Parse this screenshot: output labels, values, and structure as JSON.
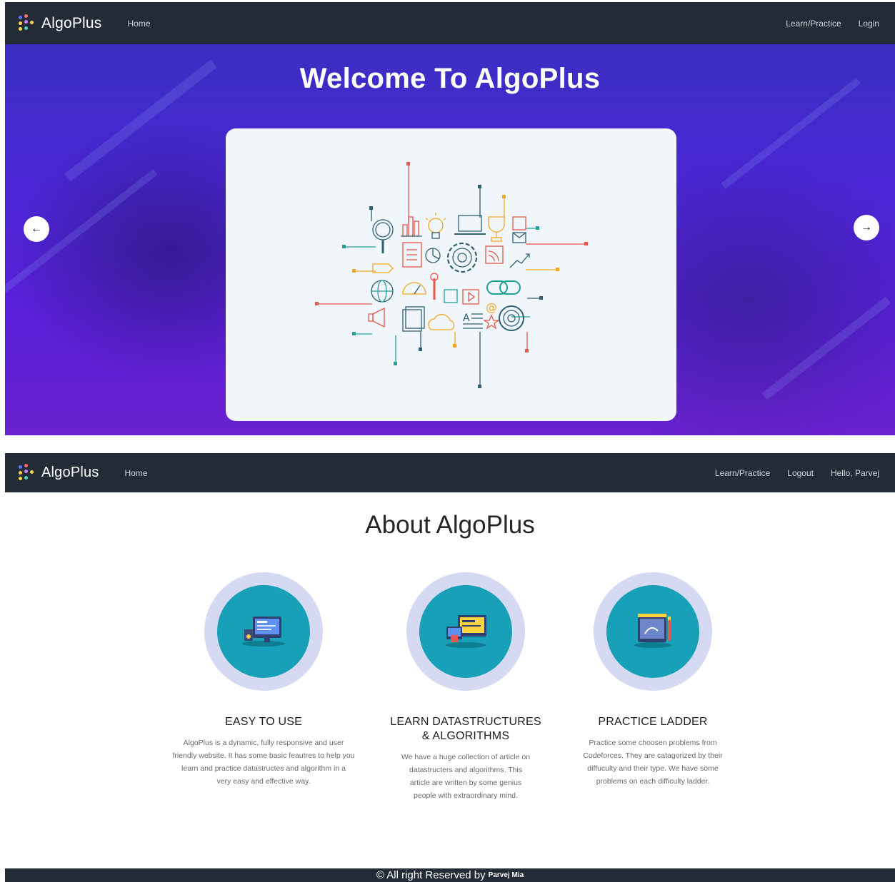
{
  "brand": {
    "name": "AlgoPlus"
  },
  "top_nav": {
    "home": "Home",
    "learn": "Learn/Practice",
    "login": "Login"
  },
  "hero": {
    "title": "Welcome To AlgoPlus",
    "prev_icon": "arrow-left-icon",
    "next_icon": "arrow-right-icon",
    "prev_glyph": "←",
    "next_glyph": "→"
  },
  "second_nav": {
    "home": "Home",
    "learn": "Learn/Practice",
    "logout": "Logout",
    "greeting": "Hello, Parvej"
  },
  "about": {
    "title": "About AlgoPlus",
    "features": [
      {
        "icon": "desktop-computer-icon",
        "title": "EASY TO USE",
        "lines": [
          "AlgoPlus is a dynamic, fully responsive and user",
          "friendly website. It has some basic feautres to help you",
          "learn and practice datastructes and algorithm in a",
          "very easy and effective way."
        ]
      },
      {
        "icon": "devices-icon",
        "title_lines": [
          "LEARN DATASTRUCTURES",
          "& ALGORITHMS"
        ],
        "lines": [
          "We have a huge collection of article on",
          "datastructers and algorithms. This",
          "article are written by some genius",
          "people with extraordinary mind."
        ]
      },
      {
        "icon": "tablet-drawing-icon",
        "title": "PRACTICE LADDER",
        "lines": [
          "Practice some choosen problems from",
          "Codeforces. They are catagorized by their",
          "diffuculty and their type. We have some",
          "problems on each difficulty ladder."
        ]
      }
    ]
  },
  "footer": {
    "text": "© All right Reserved by",
    "author": "Parvej Mia"
  },
  "colors": {
    "navbar": "#232b36",
    "hero_purple": "#4a26d6",
    "feature_teal": "#17a0b8",
    "feature_ring": "#d6d9f2"
  }
}
